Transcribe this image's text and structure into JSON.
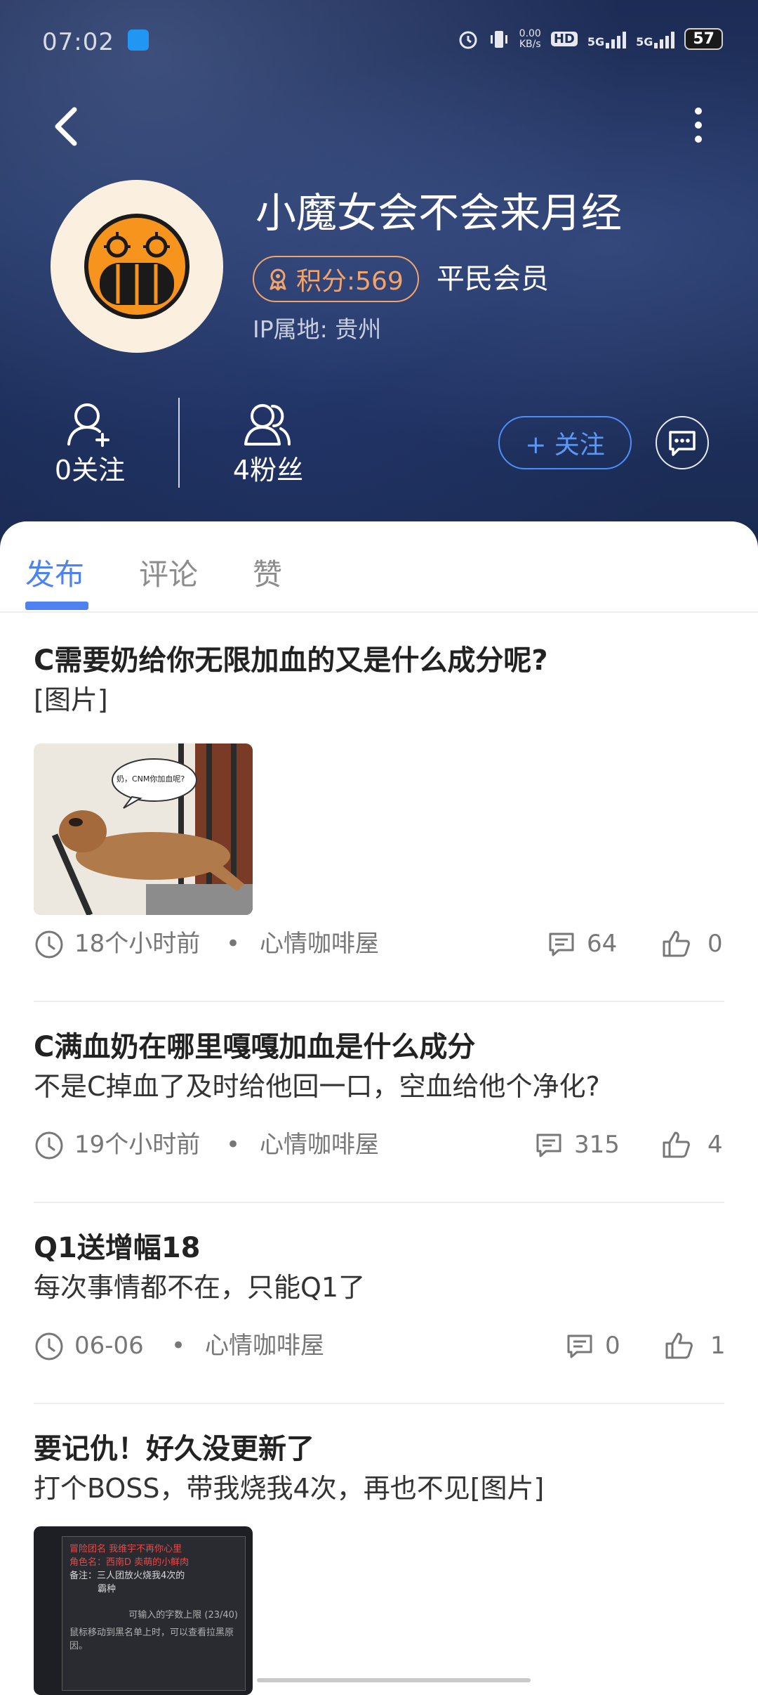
{
  "status_bar": {
    "time": "07:02",
    "net_speed_value": "0.00",
    "net_speed_unit": "KB/s",
    "hd_label": "HD",
    "sig1_label": "5G",
    "sig2_label": "5G",
    "battery": "57"
  },
  "profile": {
    "username": "小魔女会不会来月经",
    "score_label": "积分:569",
    "level": "平民会员",
    "ip_location": "IP属地: 贵州",
    "following_label": "0关注",
    "followers_label": "4粉丝",
    "follow_button": "+ 关注"
  },
  "tabs": [
    {
      "label": "发布",
      "active": true
    },
    {
      "label": "评论",
      "active": false
    },
    {
      "label": "赞",
      "active": false
    }
  ],
  "posts": [
    {
      "title": "C需要奶给你无限加血的又是什么成分呢?",
      "body": "[图片]",
      "image_caption": "奶，CNM你加血呢?",
      "time": "18个小时前",
      "forum": "心情咖啡屋",
      "comments": "64",
      "likes": "0"
    },
    {
      "title": "C满血奶在哪里嘎嘎加血是什么成分",
      "body": "不是C掉血了及时给他回一口，空血给他个净化?",
      "time": "19个小时前",
      "forum": "心情咖啡屋",
      "comments": "315",
      "likes": "4"
    },
    {
      "title": "Q1送增幅18",
      "body": "每次事情都不在，只能Q1了",
      "time": "06-06",
      "forum": "心情咖啡屋",
      "comments": "0",
      "likes": "1"
    },
    {
      "title": "要记仇！好久没更新了",
      "body": "打个BOSS，带我烧我4次，再也不见[图片]",
      "image_lines": [
        "冒险团名 我维宇不再你心里",
        "角色名：西南D 卖萌的小鲜肉",
        "备注：三人团放火烧我4次的",
        "霸种",
        "可输入的字数上限 (23/40)",
        "鼠标移动到黑名单上时，可以查看拉黑原因。"
      ]
    }
  ],
  "colors": {
    "accent": "#4d82f0",
    "score_orange": "#f3a46a",
    "header_bg": "#1f3161"
  }
}
